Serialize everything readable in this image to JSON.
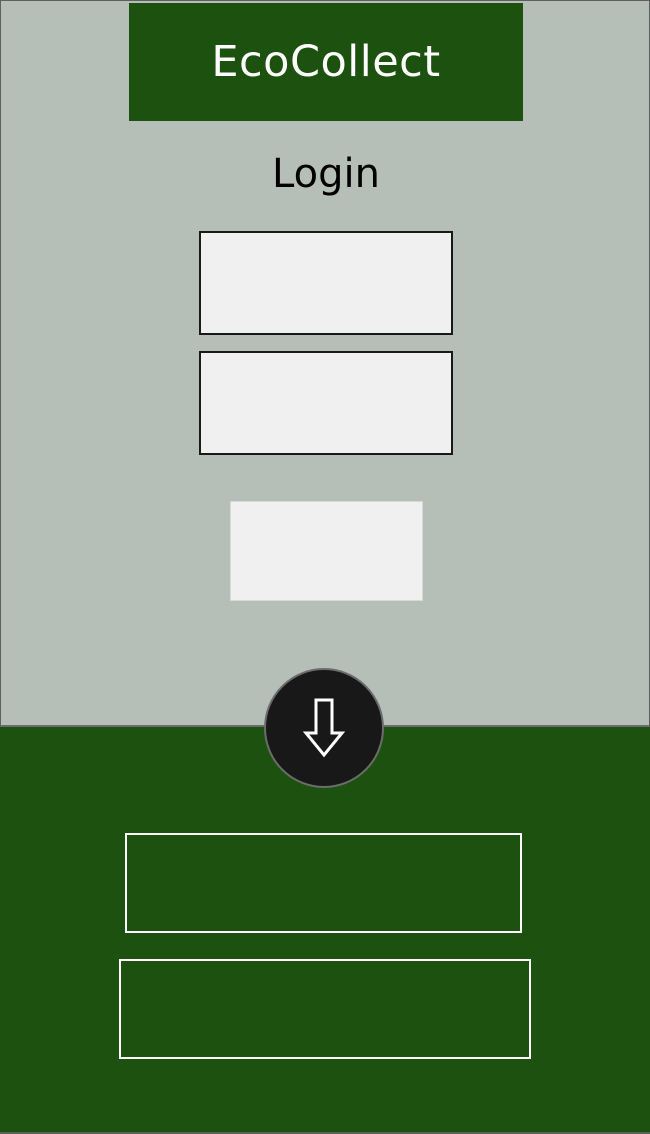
{
  "app": {
    "title": "EcoCollect"
  },
  "login": {
    "heading": "Login",
    "username_value": "",
    "password_value": "",
    "submit_label": ""
  },
  "scroll": {
    "icon": "arrow-down-icon"
  },
  "actions": {
    "primary_label": "",
    "secondary_label": ""
  },
  "colors": {
    "brand_green": "#1d510f",
    "panel_gray": "#b6beb8",
    "field_fill": "#f0f0f0",
    "scroll_button": "#181818"
  }
}
